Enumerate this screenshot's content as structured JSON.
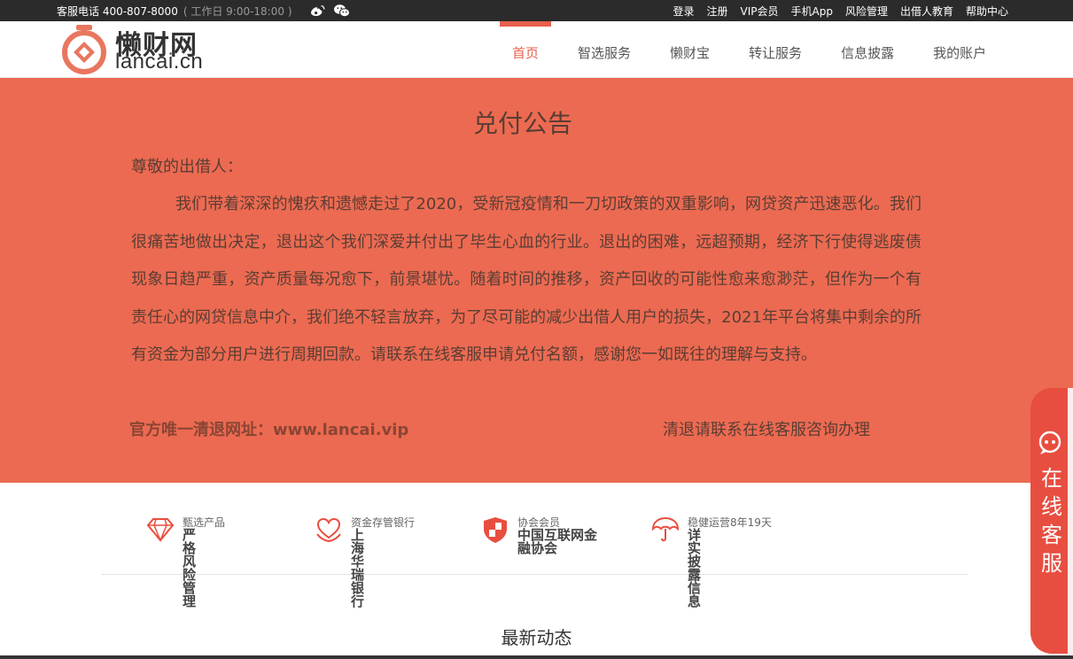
{
  "topbar": {
    "hotline": "客服电话 400-807-8000",
    "hours": "( 工作日 9:00-18:00 )",
    "social_icons": [
      "weibo-icon",
      "wechat-icon"
    ],
    "links": [
      "登录",
      "注册",
      "VIP会员",
      "手机App",
      "风险管理",
      "出借人教育",
      "帮助中心"
    ]
  },
  "header": {
    "logo_cn": "懒财网",
    "logo_en": "lancai.cn",
    "nav": [
      {
        "label": "首页",
        "active": true
      },
      {
        "label": "智选服务",
        "active": false
      },
      {
        "label": "懒财宝",
        "active": false
      },
      {
        "label": "转让服务",
        "active": false
      },
      {
        "label": "信息披露",
        "active": false
      },
      {
        "label": "我的账户",
        "active": false
      }
    ]
  },
  "notice": {
    "title": "兑付公告",
    "greeting": "尊敬的出借人：",
    "body": "我们带着深深的愧疚和遗憾走过了2020，受新冠疫情和一刀切政策的双重影响，网贷资产迅速恶化。我们很痛苦地做出决定，退出这个我们深爱并付出了毕生心血的行业。退出的困难，远超预期，经济下行使得逃废债现象日趋严重，资产质量每况愈下，前景堪忧。随着时间的推移，资产回收的可能性愈来愈渺茫，但作为一个有责任心的网贷信息中介，我们绝不轻言放弃，为了尽可能的减少出借人用户的损失，2021年平台将集中剩余的所有资金为部分用户进行周期回款。请联系在线客服申请兑付名额，感谢您一如既往的理解与支持。",
    "official_site": "官方唯一清退网址：www.lancai.vip",
    "contact": "清退请联系在线客服咨询办理"
  },
  "features": [
    {
      "icon": "diamond-icon",
      "small": "甄选产品",
      "big": "严格风险管理"
    },
    {
      "icon": "heart-hands-icon",
      "small": "资金存管银行",
      "big": "上海华瑞银行"
    },
    {
      "icon": "shield-icon",
      "small": "协会会员",
      "big": "中国互联网金融协会"
    },
    {
      "icon": "umbrella-icon",
      "small": "稳健运营8年19天",
      "big": "详实披露信息"
    }
  ],
  "news": {
    "title": "最新动态"
  },
  "service": {
    "label": "在线客服",
    "icon": "chat-bubble-icon"
  },
  "colors": {
    "banner": "#ec6a51",
    "accent": "#e8604d",
    "topbar": "#2b2b2b",
    "service": "#e84e40"
  }
}
